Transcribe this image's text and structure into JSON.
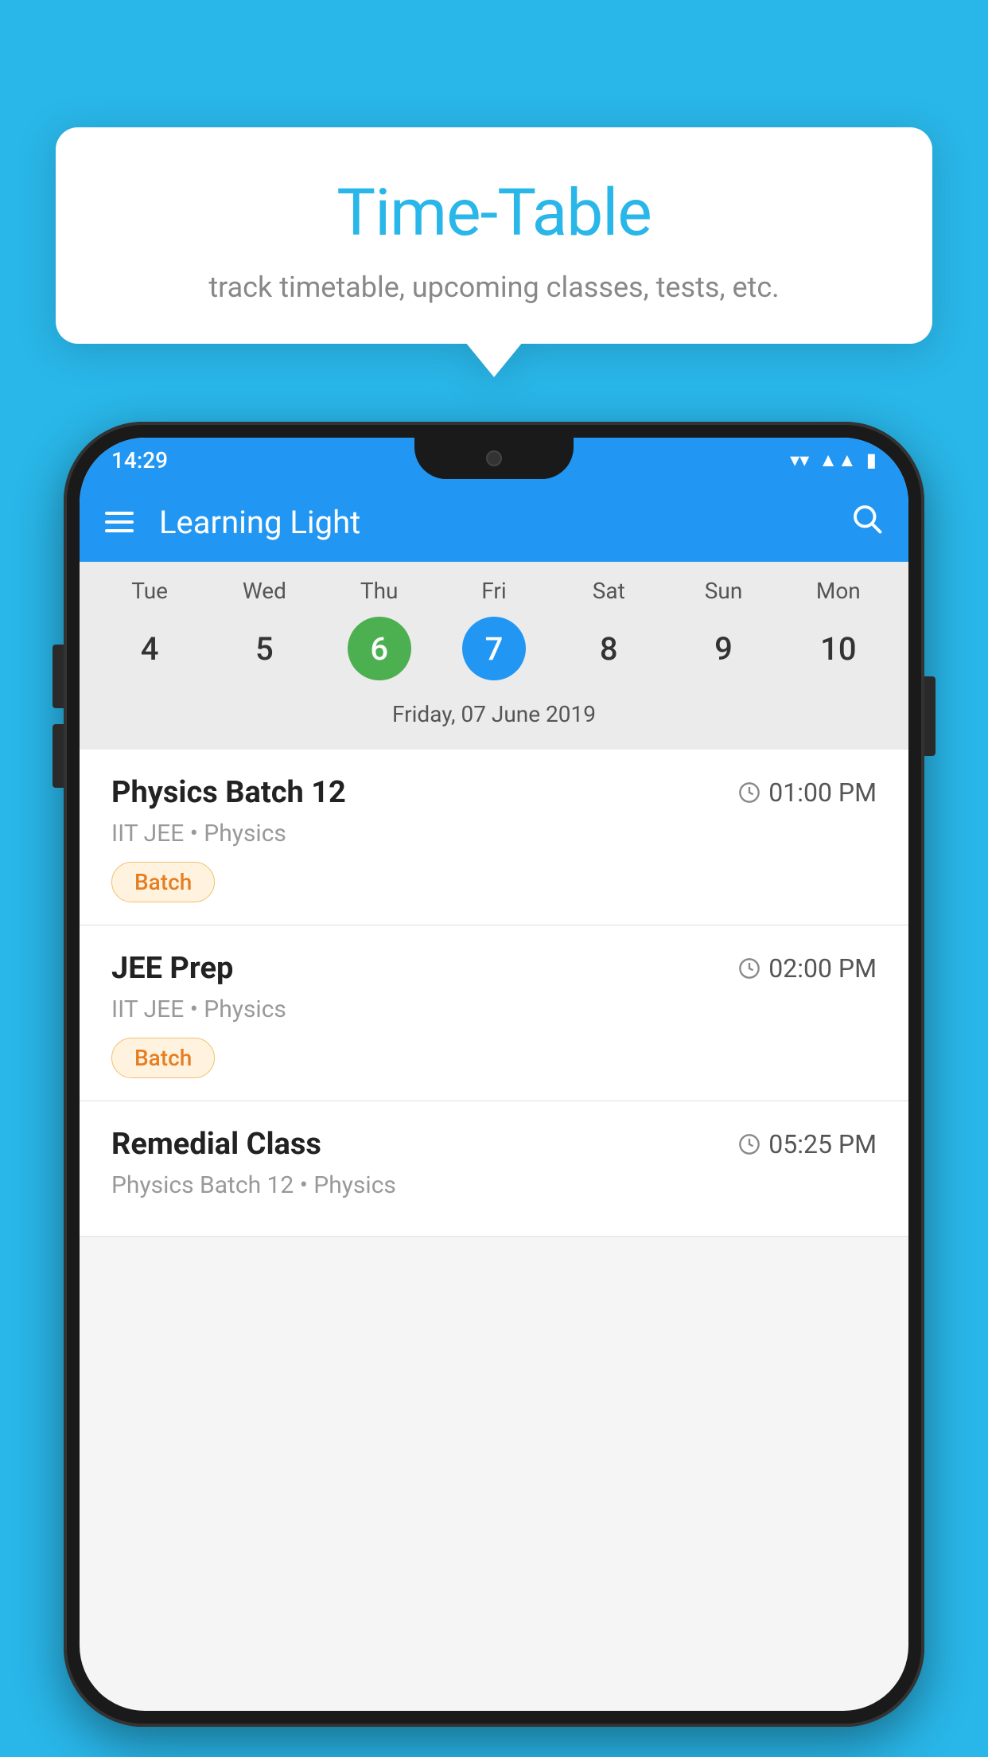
{
  "background_color": "#29b6e8",
  "tooltip": {
    "title": "Time-Table",
    "subtitle": "track timetable, upcoming classes, tests, etc."
  },
  "phone": {
    "status_bar": {
      "time": "14:29"
    },
    "app_bar": {
      "title": "Learning Light"
    },
    "calendar": {
      "days": [
        {
          "name": "Tue",
          "num": "4",
          "state": "normal"
        },
        {
          "name": "Wed",
          "num": "5",
          "state": "normal"
        },
        {
          "name": "Thu",
          "num": "6",
          "state": "today"
        },
        {
          "name": "Fri",
          "num": "7",
          "state": "selected"
        },
        {
          "name": "Sat",
          "num": "8",
          "state": "normal"
        },
        {
          "name": "Sun",
          "num": "9",
          "state": "normal"
        },
        {
          "name": "Mon",
          "num": "10",
          "state": "normal"
        }
      ],
      "selected_date_label": "Friday, 07 June 2019"
    },
    "classes": [
      {
        "name": "Physics Batch 12",
        "time": "01:00 PM",
        "meta": "IIT JEE • Physics",
        "badge": "Batch"
      },
      {
        "name": "JEE Prep",
        "time": "02:00 PM",
        "meta": "IIT JEE • Physics",
        "badge": "Batch"
      },
      {
        "name": "Remedial Class",
        "time": "05:25 PM",
        "meta": "Physics Batch 12 • Physics",
        "badge": null
      }
    ]
  }
}
